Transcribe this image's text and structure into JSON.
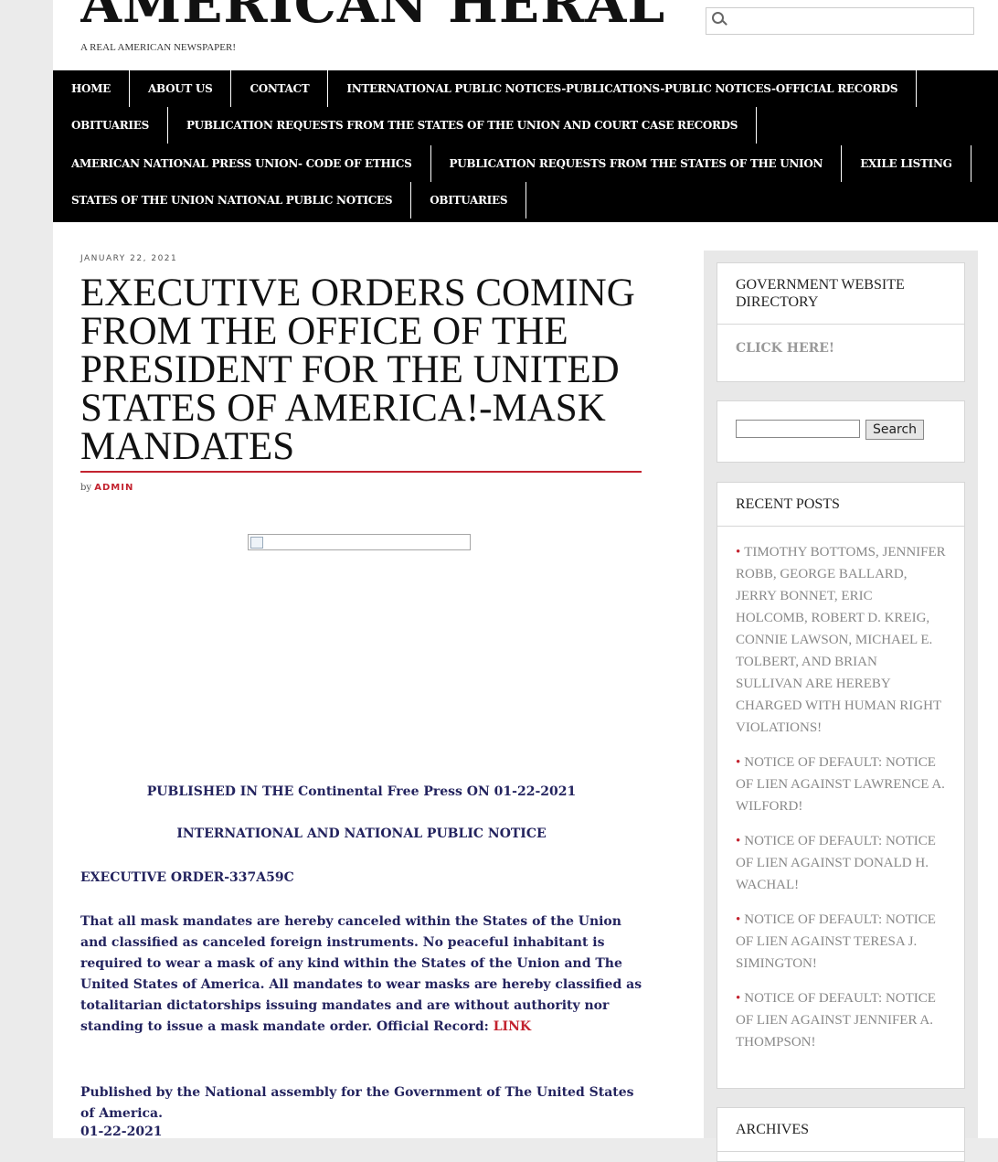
{
  "site": {
    "title": "AMERICAN HERALD",
    "tagline": "A REAL AMERICAN NEWSPAPER!",
    "search_placeholder": ""
  },
  "nav": {
    "rows": [
      [
        "HOME",
        "ABOUT US",
        "CONTACT",
        "INTERNATIONAL PUBLIC NOTICES-PUBLICATIONS-PUBLIC NOTICES-OFFICIAL RECORDS"
      ],
      [
        "OBITUARIES",
        "PUBLICATION REQUESTS FROM THE STATES OF THE UNION AND COURT CASE RECORDS"
      ],
      [
        "AMERICAN NATIONAL PRESS UNION- CODE OF ETHICS",
        "PUBLICATION REQUESTS FROM THE STATES OF THE UNION",
        "EXILE LISTING"
      ],
      [
        "STATES OF THE UNION NATIONAL PUBLIC NOTICES",
        "OBITUARIES"
      ]
    ]
  },
  "post": {
    "date": "JANUARY 22, 2021",
    "title": "EXECUTIVE ORDERS COMING FROM THE OFFICE OF THE PRESIDENT FOR THE UNITED STATES OF AMERICA!-MASK MANDATES",
    "by_label": "by",
    "author": "ADMIN",
    "published_line": "PUBLISHED IN THE Continental Free Press ON 01-22-2021",
    "notice_heading": "INTERNATIONAL AND NATIONAL PUBLIC NOTICE",
    "order_number": "EXECUTIVE ORDER-337A59C",
    "body": "That all mask mandates are hereby canceled within the States of the Union and classified as canceled foreign instruments. No peaceful inhabitant is required to wear a mask of any kind within the States of the Union and The United States of America. All mandates to wear masks are hereby classified as totalitarian dictatorships issuing mandates and are without authority nor standing to issue a mask mandate order. Official Record:",
    "link_label": "LINK",
    "published_by": "Published by the National assembly for the Government of The United States of America.",
    "footer_date": "01-22-2021"
  },
  "sidebar": {
    "directory_title": "GOVERNMENT WEBSITE DIRECTORY",
    "directory_link": "CLICK HERE!",
    "search_button": "Search",
    "recent_title": "RECENT POSTS",
    "recent_posts": [
      "TIMOTHY BOTTOMS, JENNIFER ROBB, GEORGE BALLARD, JERRY BONNET, ERIC HOLCOMB, ROBERT D. KREIG, CONNIE LAWSON, MICHAEL E. TOLBERT, AND BRIAN SULLIVAN ARE HEREBY CHARGED WITH HUMAN RIGHT VIOLATIONS!",
      "NOTICE OF DEFAULT: NOTICE OF LIEN AGAINST LAWRENCE A. WILFORD!",
      "NOTICE OF DEFAULT: NOTICE OF LIEN AGAINST DONALD H. WACHAL!",
      "NOTICE OF DEFAULT: NOTICE OF LIEN AGAINST TERESA J. SIMINGTON!",
      "NOTICE OF DEFAULT: NOTICE OF LIEN AGAINST JENNIFER A. THOMPSON!"
    ],
    "archives_title": "ARCHIVES"
  },
  "colors": {
    "accent": "#c3232f",
    "nav_bg": "#000000",
    "body_text": "#23235e"
  }
}
